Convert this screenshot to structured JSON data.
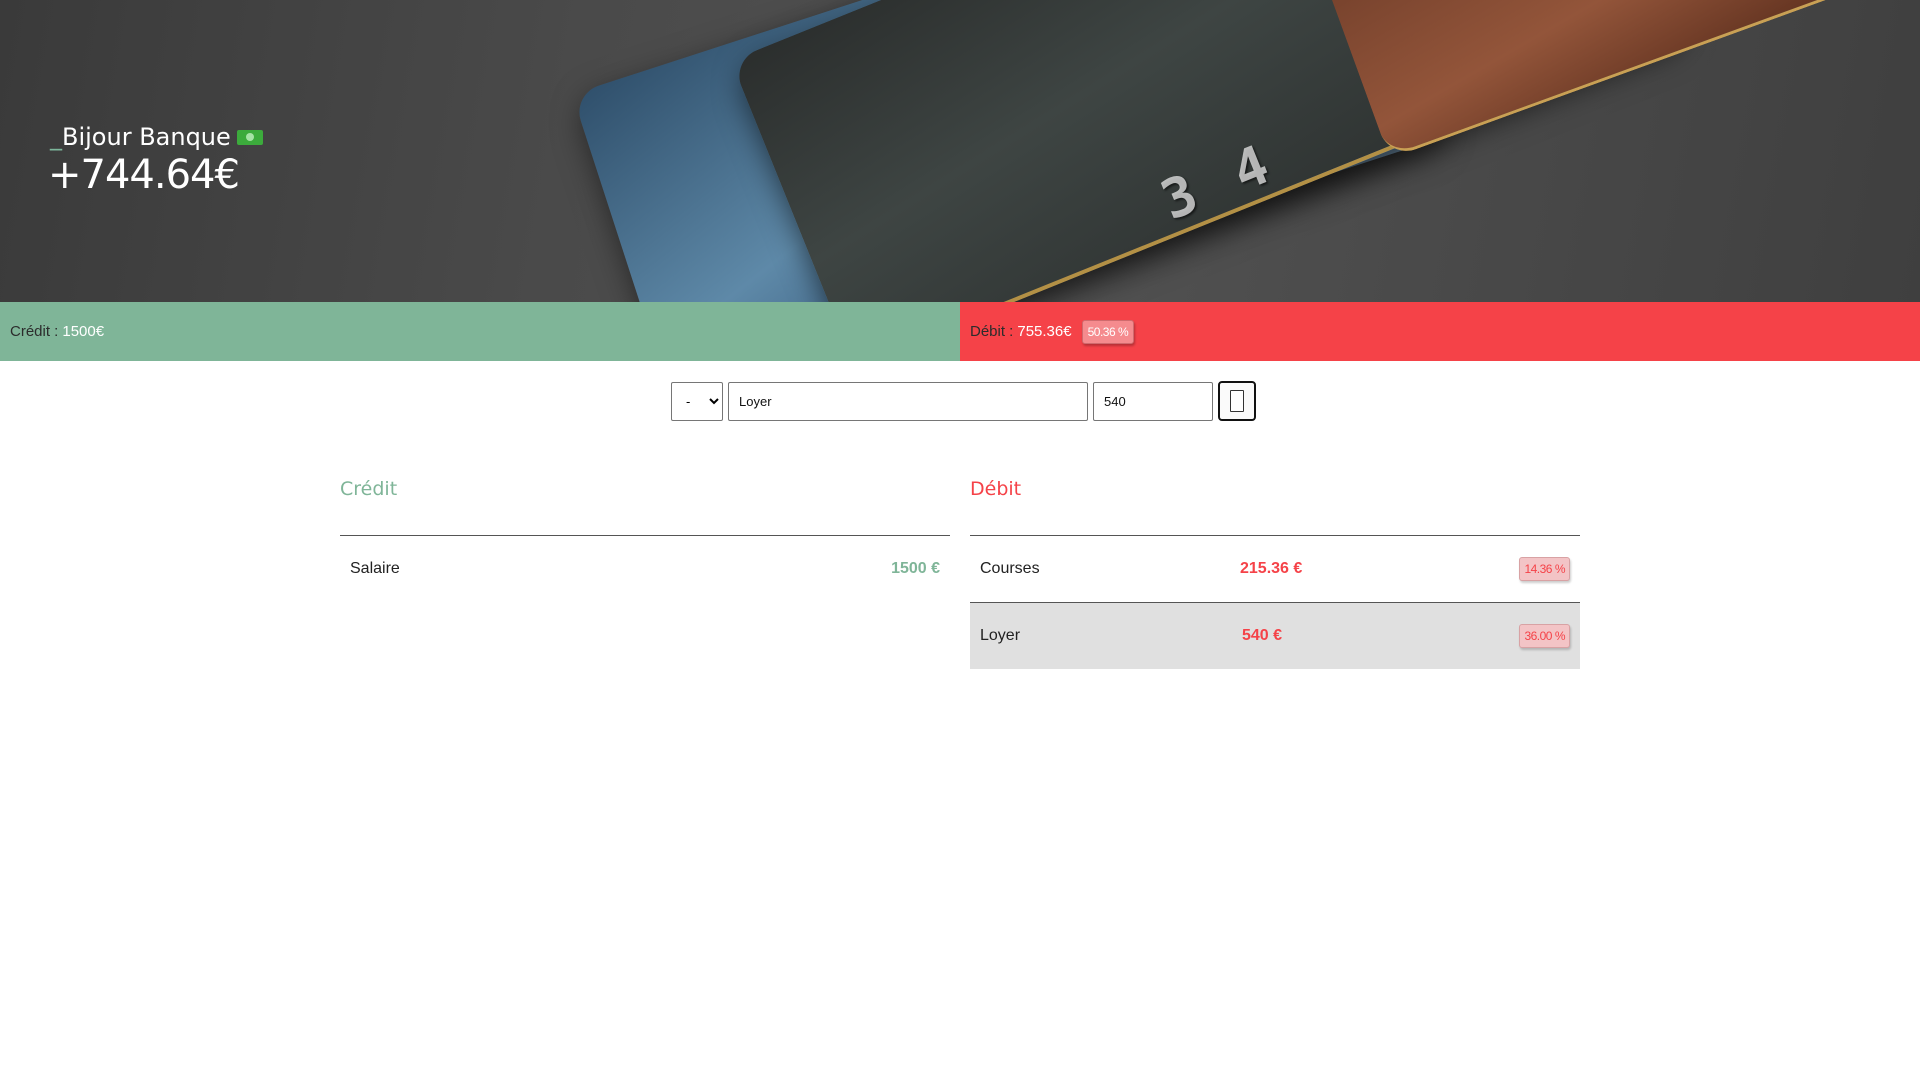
{
  "header": {
    "brand_prefix": "_",
    "brand_name": "Bijour Banque",
    "brand_icon": "money-icon",
    "balance": "+744.64€"
  },
  "summary": {
    "credit_label": "Crédit :",
    "credit_value": "1500€",
    "debit_label": "Débit :",
    "debit_value": "755.36€",
    "debit_percent": "50.36 %",
    "credit_color": "#7fb598",
    "debit_color": "#f54248"
  },
  "form": {
    "type_selected": "-",
    "label_value": "Loyer",
    "amount_value": "540",
    "submit_icon": "device-icon"
  },
  "credit": {
    "title": "Crédit",
    "items": [
      {
        "label": "Salaire",
        "amount": "1500 €"
      }
    ]
  },
  "debit": {
    "title": "Débit",
    "items": [
      {
        "label": "Courses",
        "amount": "215.36 €",
        "percent": "14.36 %"
      },
      {
        "label": "Loyer",
        "amount": "540 €",
        "percent": "36.00 %"
      }
    ]
  }
}
